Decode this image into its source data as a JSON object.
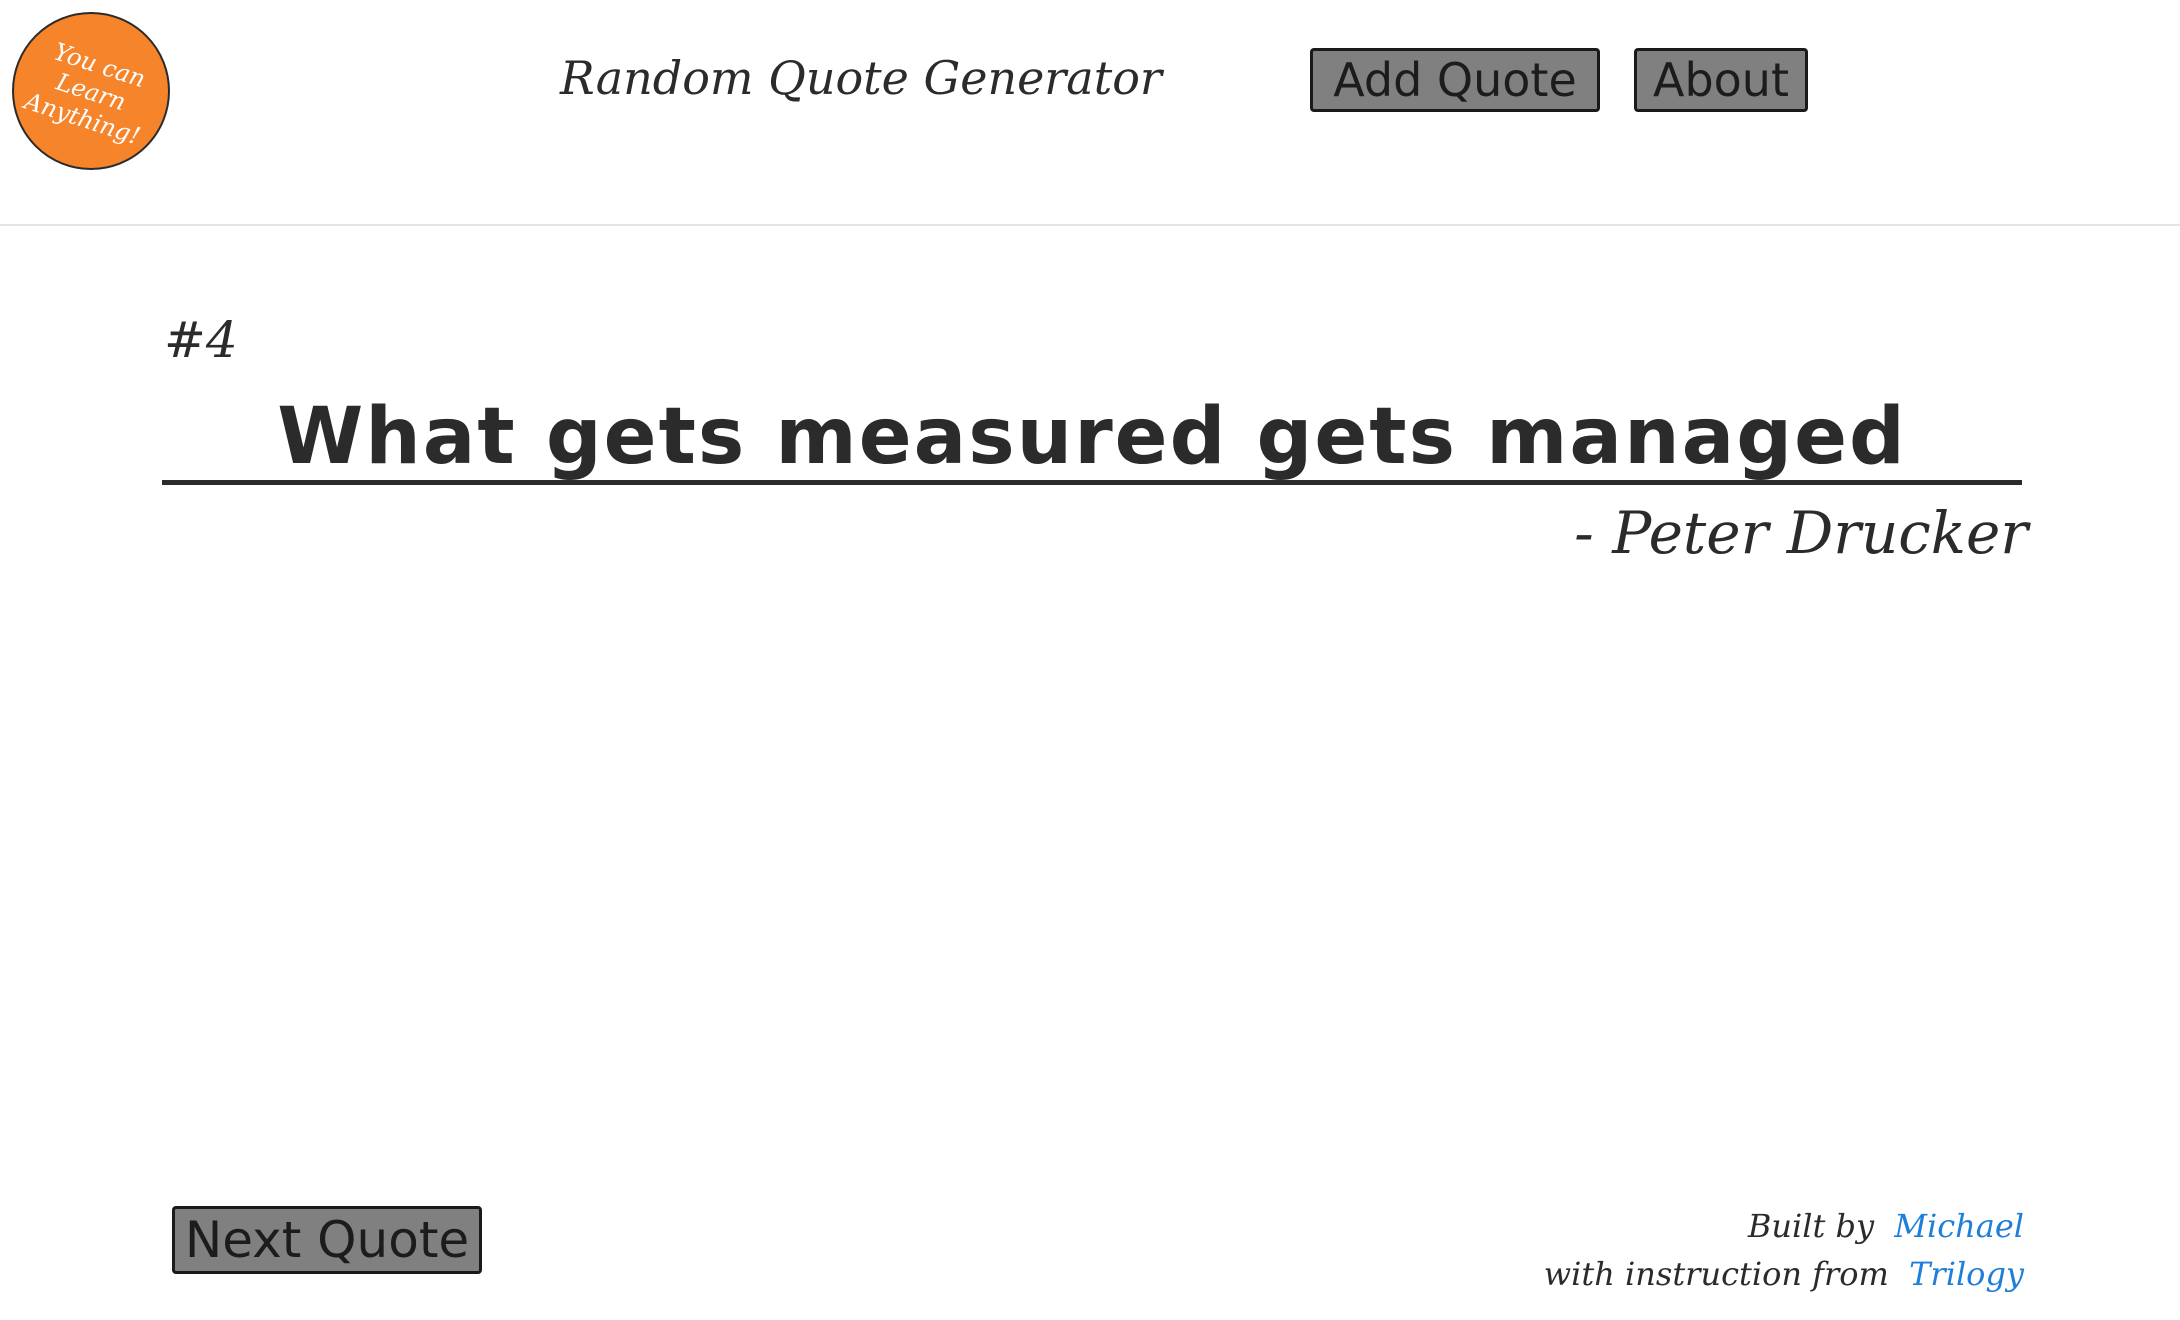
{
  "logo": {
    "lines": [
      "You can",
      "Learn",
      "Anything!"
    ],
    "color": "#f5842b"
  },
  "header": {
    "title": "Random Quote Generator",
    "nav": {
      "add_quote_label": "Add Quote",
      "about_label": "About"
    }
  },
  "quote": {
    "number": "#4",
    "text": "What gets measured gets managed",
    "author": "- Peter Drucker"
  },
  "controls": {
    "next_label": "Next Quote"
  },
  "footer": {
    "built_by_prefix": "Built by",
    "built_by_name": "Michael",
    "instruction_prefix": "with instruction from",
    "instruction_name": "Trilogy",
    "link_color": "#1e7fd8"
  },
  "colors": {
    "button_fill": "#808080",
    "text": "#2b2b2b"
  }
}
